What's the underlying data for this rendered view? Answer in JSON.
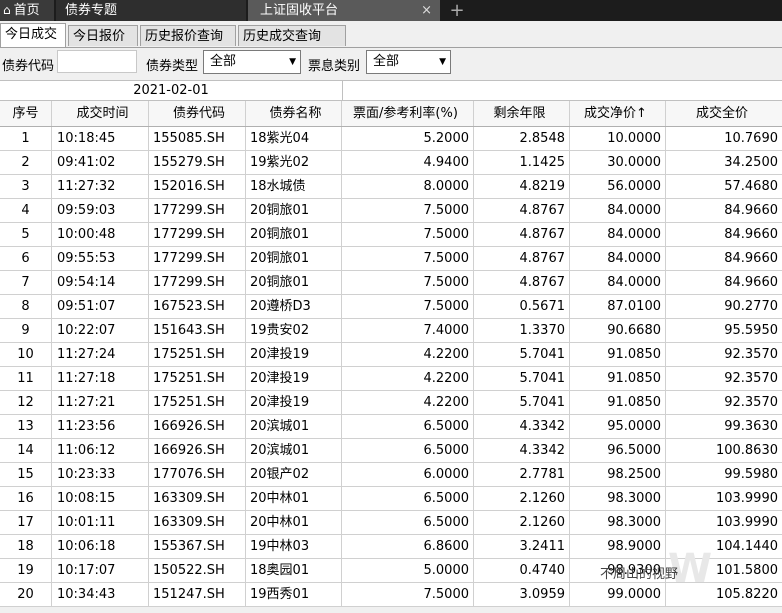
{
  "window_tabs": {
    "home": "首页",
    "bond_topic": "债券专题",
    "sh_fixed_income": "上证固收平台",
    "close_symbol": "×",
    "new_tab_symbol": "+"
  },
  "sub_tabs": [
    "今日成交",
    "今日报价",
    "历史报价查询",
    "历史成交查询"
  ],
  "filters": {
    "bond_code_label": "债券代码",
    "bond_code_value": "",
    "bond_type_label": "债券类型",
    "bond_type_value": "全部",
    "coupon_type_label": "票息类别",
    "coupon_type_value": "全部"
  },
  "table": {
    "date": "2021-02-01",
    "headers": [
      "序号",
      "成交时间",
      "债券代码",
      "债券名称",
      "票面/参考利率(%)",
      "剩余年限",
      "成交净价↑",
      "成交全价"
    ],
    "rows": [
      [
        "1",
        "10:18:45",
        "155085.SH",
        "18紫光04",
        "5.2000",
        "2.8548",
        "10.0000",
        "10.7690"
      ],
      [
        "2",
        "09:41:02",
        "155279.SH",
        "19紫光02",
        "4.9400",
        "1.1425",
        "30.0000",
        "34.2500"
      ],
      [
        "3",
        "11:27:32",
        "152016.SH",
        "18水城债",
        "8.0000",
        "4.8219",
        "56.0000",
        "57.4680"
      ],
      [
        "4",
        "09:59:03",
        "177299.SH",
        "20铜旅01",
        "7.5000",
        "4.8767",
        "84.0000",
        "84.9660"
      ],
      [
        "5",
        "10:00:48",
        "177299.SH",
        "20铜旅01",
        "7.5000",
        "4.8767",
        "84.0000",
        "84.9660"
      ],
      [
        "6",
        "09:55:53",
        "177299.SH",
        "20铜旅01",
        "7.5000",
        "4.8767",
        "84.0000",
        "84.9660"
      ],
      [
        "7",
        "09:54:14",
        "177299.SH",
        "20铜旅01",
        "7.5000",
        "4.8767",
        "84.0000",
        "84.9660"
      ],
      [
        "8",
        "09:51:07",
        "167523.SH",
        "20遵桥D3",
        "7.5000",
        "0.5671",
        "87.0100",
        "90.2770"
      ],
      [
        "9",
        "10:22:07",
        "151643.SH",
        "19贵安02",
        "7.4000",
        "1.3370",
        "90.6680",
        "95.5950"
      ],
      [
        "10",
        "11:27:24",
        "175251.SH",
        "20津投19",
        "4.2200",
        "5.7041",
        "91.0850",
        "92.3570"
      ],
      [
        "11",
        "11:27:18",
        "175251.SH",
        "20津投19",
        "4.2200",
        "5.7041",
        "91.0850",
        "92.3570"
      ],
      [
        "12",
        "11:27:21",
        "175251.SH",
        "20津投19",
        "4.2200",
        "5.7041",
        "91.0850",
        "92.3570"
      ],
      [
        "13",
        "11:23:56",
        "166926.SH",
        "20滨城01",
        "6.5000",
        "4.3342",
        "95.0000",
        "99.3630"
      ],
      [
        "14",
        "11:06:12",
        "166926.SH",
        "20滨城01",
        "6.5000",
        "4.3342",
        "96.5000",
        "100.8630"
      ],
      [
        "15",
        "10:23:33",
        "177076.SH",
        "20银产02",
        "6.0000",
        "2.7781",
        "98.2500",
        "99.5980"
      ],
      [
        "16",
        "10:08:15",
        "163309.SH",
        "20中林01",
        "6.5000",
        "2.1260",
        "98.3000",
        "103.9990"
      ],
      [
        "17",
        "10:01:11",
        "163309.SH",
        "20中林01",
        "6.5000",
        "2.1260",
        "98.3000",
        "103.9990"
      ],
      [
        "18",
        "10:06:18",
        "155367.SH",
        "19中林03",
        "6.8600",
        "3.2411",
        "98.9000",
        "104.1440"
      ],
      [
        "19",
        "10:17:07",
        "150522.SH",
        "18奥园01",
        "5.0000",
        "0.4740",
        "98.9300",
        "101.5800"
      ],
      [
        "20",
        "10:34:43",
        "151247.SH",
        "19西秀01",
        "7.5000",
        "3.0959",
        "99.0000",
        "105.8220"
      ]
    ]
  },
  "watermark": "不周山的视野"
}
